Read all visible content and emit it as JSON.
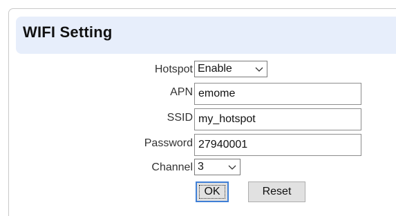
{
  "panel": {
    "title": "WIFI Setting"
  },
  "form": {
    "hotspot": {
      "label": "Hotspot",
      "value": "Enable"
    },
    "apn": {
      "label": "APN",
      "value": "emome"
    },
    "ssid": {
      "label": "SSID",
      "value": "my_hotspot"
    },
    "password": {
      "label": "Password",
      "value": "27940001"
    },
    "channel": {
      "label": "Channel",
      "value": "3"
    }
  },
  "buttons": {
    "ok_label": "OK",
    "reset_label": "Reset"
  },
  "icons": {
    "dropdown": "chevron-down-icon"
  },
  "colors": {
    "header_background": "#e7eefb",
    "focus_border": "#3f7fd6"
  }
}
